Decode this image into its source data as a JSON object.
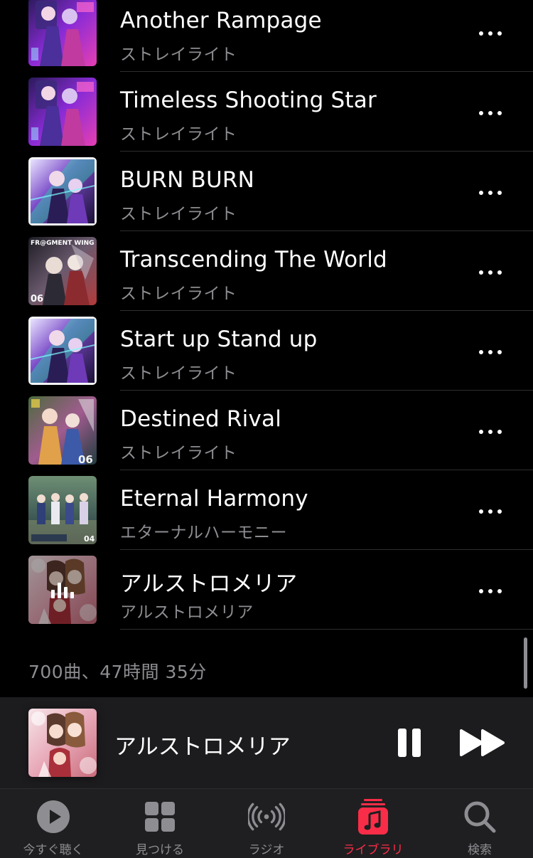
{
  "songs": [
    {
      "title": "Another Rampage",
      "artist": "ストレイライト",
      "artwork": "art-a"
    },
    {
      "title": "Timeless Shooting Star",
      "artist": "ストレイライト",
      "artwork": "art-a"
    },
    {
      "title": "BURN BURN",
      "artist": "ストレイライト",
      "artwork": "art-b"
    },
    {
      "title": "Transcending The World",
      "artist": "ストレイライト",
      "artwork": "art-c",
      "art_text_top": "FR@GMENT WING",
      "art_text_bottom": "06"
    },
    {
      "title": "Start up Stand up",
      "artist": "ストレイライト",
      "artwork": "art-b"
    },
    {
      "title": "Destined Rival",
      "artist": "ストレイライト",
      "artwork": "art-d",
      "art_text_bottom": "06"
    },
    {
      "title": "Eternal Harmony",
      "artist": "エターナルハーモニー",
      "artwork": "art-e",
      "art_text_bottom": "04"
    },
    {
      "title": "アルストロメリア",
      "artist": "アルストロメリア",
      "artwork": "art-f",
      "now_playing": true
    }
  ],
  "footer": {
    "summary": "700曲、47時間 35分"
  },
  "mini_player": {
    "title": "アルストロメリア",
    "state": "playing"
  },
  "tabs": [
    {
      "label": "今すぐ聴く",
      "icon": "play-circle-icon",
      "active": false
    },
    {
      "label": "見つける",
      "icon": "grid-icon",
      "active": false
    },
    {
      "label": "ラジオ",
      "icon": "radio-broadcast-icon",
      "active": false
    },
    {
      "label": "ライブラリ",
      "icon": "music-library-icon",
      "active": true
    },
    {
      "label": "検索",
      "icon": "search-icon",
      "active": false
    }
  ],
  "colors": {
    "accent": "#fa2d48",
    "secondary_text": "#8d8d92",
    "background": "#000000",
    "bar": "#1c1c1e"
  }
}
